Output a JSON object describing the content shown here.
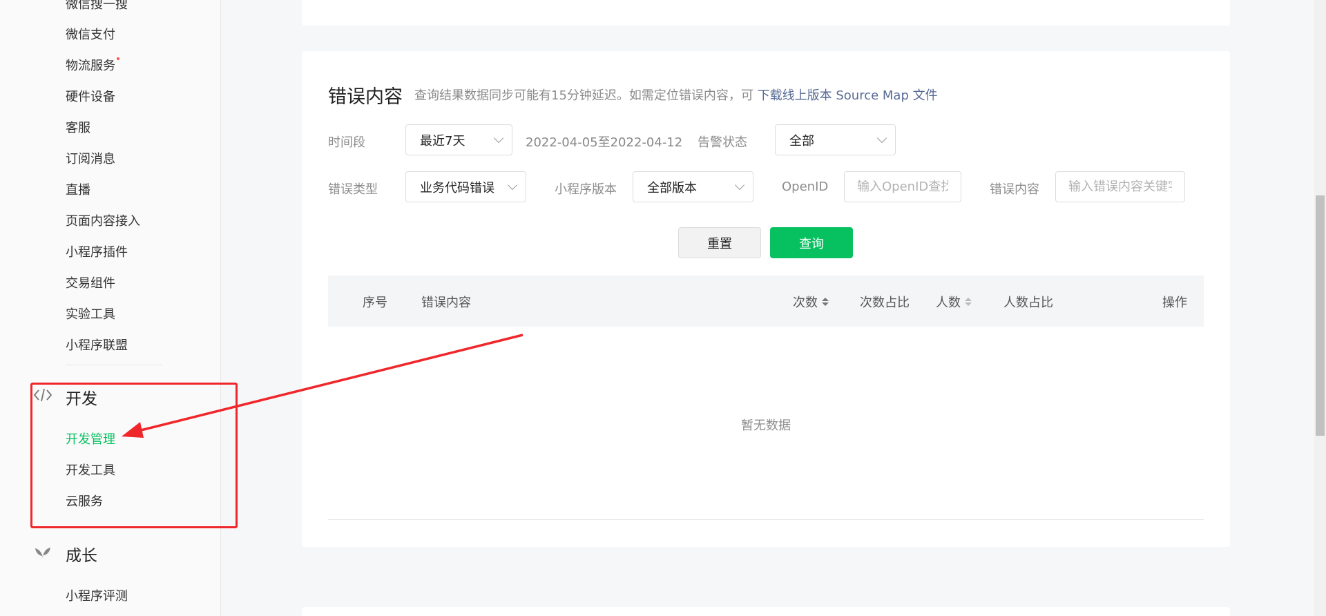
{
  "sidebar": {
    "items_top": [
      {
        "label": "微信搜一搜"
      },
      {
        "label": "微信支付"
      },
      {
        "label": "物流服务",
        "dot": true
      },
      {
        "label": "硬件设备"
      },
      {
        "label": "客服"
      },
      {
        "label": "订阅消息"
      },
      {
        "label": "直播"
      },
      {
        "label": "页面内容接入"
      },
      {
        "label": "小程序插件"
      },
      {
        "label": "交易组件"
      },
      {
        "label": "实验工具"
      },
      {
        "label": "小程序联盟"
      }
    ],
    "dev_section": {
      "title": "开发",
      "icon": "code-icon",
      "items": [
        {
          "label": "开发管理",
          "active": true
        },
        {
          "label": "开发工具"
        },
        {
          "label": "云服务"
        }
      ]
    },
    "growth_section": {
      "title": "成长",
      "icon": "sprout-icon",
      "items": [
        {
          "label": "小程序评测"
        }
      ]
    }
  },
  "main": {
    "title": "错误内容",
    "tip": "查询结果数据同步可能有15分钟延迟。如需定位错误内容，可",
    "tip_link": "下载线上版本 Source Map 文件",
    "filters": {
      "period_label": "时间段",
      "period_value": "最近7天",
      "date_range": "2022-04-05至2022-04-12",
      "alert_label": "告警状态",
      "alert_value": "全部",
      "error_type_label": "错误类型",
      "error_type_value": "业务代码错误",
      "version_label": "小程序版本",
      "version_value": "全部版本",
      "openid_label": "OpenID",
      "openid_placeholder": "输入OpenID查找",
      "content_label": "错误内容",
      "content_placeholder": "输入错误内容关键字"
    },
    "buttons": {
      "reset": "重置",
      "query": "查询"
    },
    "table": {
      "columns": {
        "index": "序号",
        "content": "错误内容",
        "count": "次数",
        "count_ratio": "次数占比",
        "users": "人数",
        "users_ratio": "人数占比",
        "action": "操作"
      },
      "empty_text": "暂无数据"
    }
  },
  "colors": {
    "accent": "#07c160",
    "link": "#576b95",
    "annotation": "#f0272a"
  }
}
